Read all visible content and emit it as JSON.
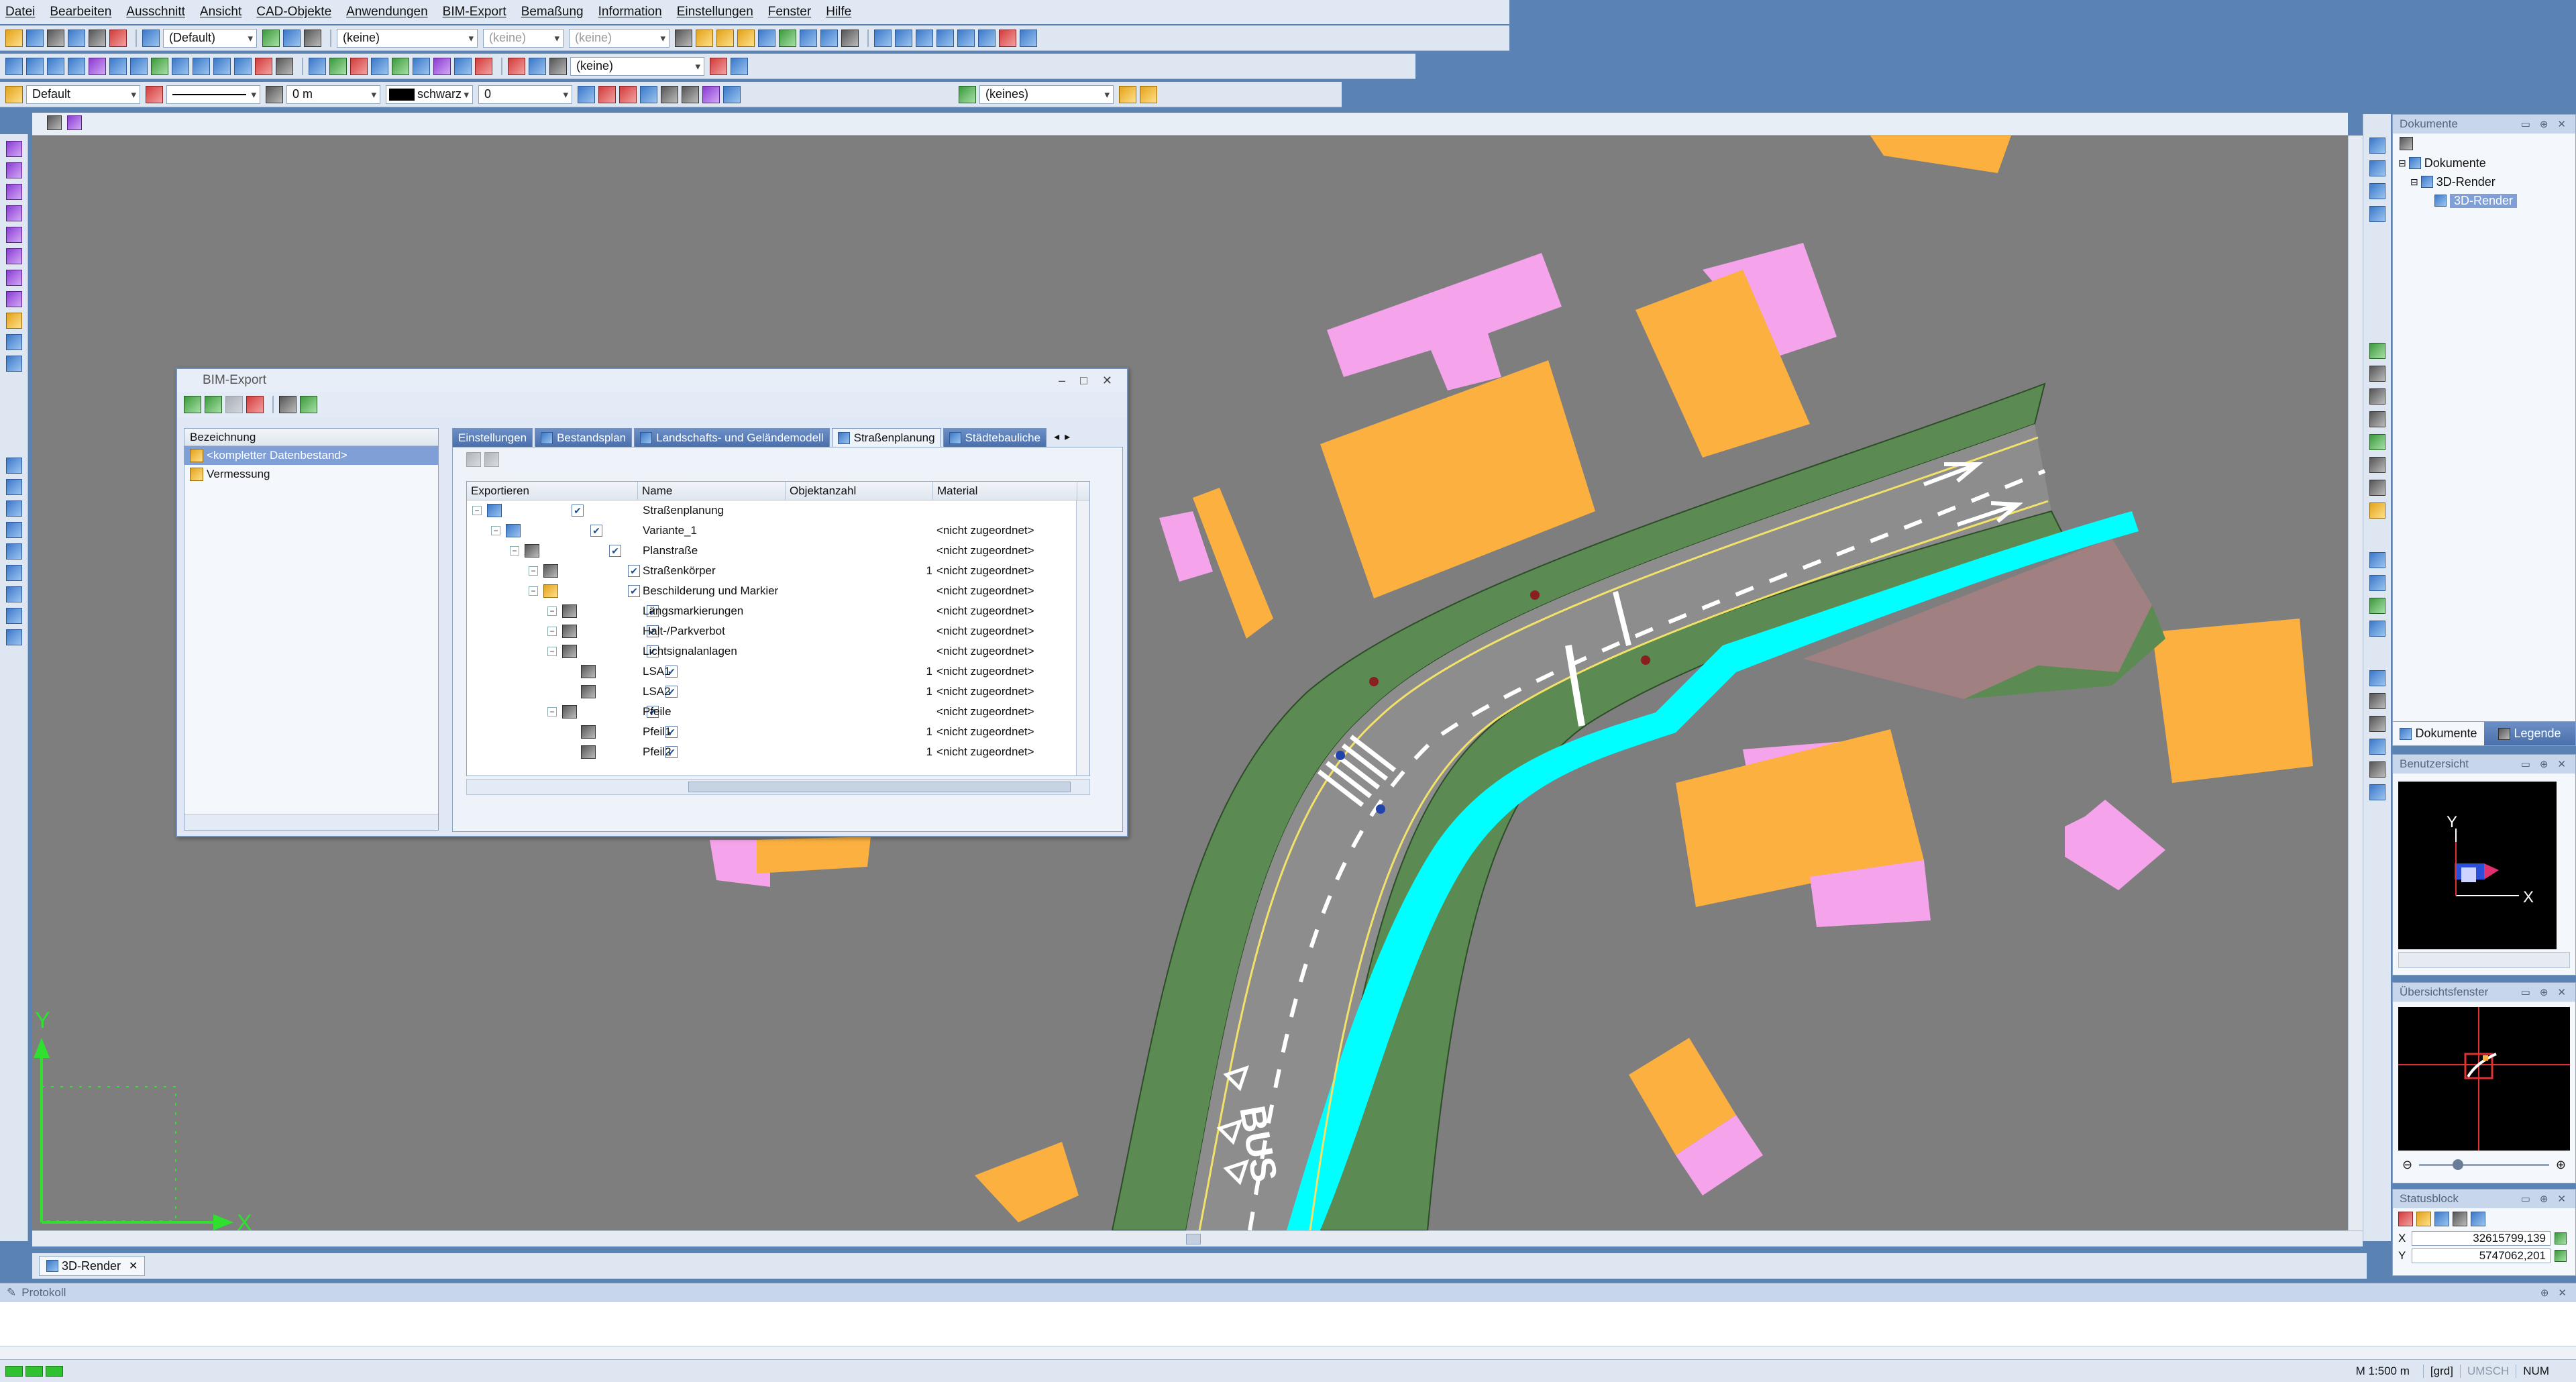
{
  "menu": [
    "Datei",
    "Bearbeiten",
    "Ausschnitt",
    "Ansicht",
    "CAD-Objekte",
    "Anwendungen",
    "BIM-Export",
    "Bemaßung",
    "Information",
    "Einstellungen",
    "Fenster",
    "Hilfe"
  ],
  "toolbar1": {
    "combo1": "(Default)",
    "combo2": "(keine)",
    "combo3": "(keine)",
    "combo4": "(keine)"
  },
  "toolbar2": {
    "combo1": "(keine)"
  },
  "toolbar3": {
    "layer": "Default",
    "length": "0 m",
    "color": "schwarz",
    "value": "0",
    "keines": "(keines)"
  },
  "dialog": {
    "title": "BIM-Export",
    "left_header": "Bezeichnung",
    "left_items": [
      "<kompletter Datenbestand>",
      "Vermessung"
    ],
    "tabs": [
      "Einstellungen",
      "Bestandsplan",
      "Landschafts- und Geländemodell",
      "Straßenplanung",
      "Städtebauliche"
    ],
    "columns": [
      "Exportieren",
      "Name",
      "Objektanzahl",
      "Material"
    ],
    "rows": [
      {
        "name": "Straßenplanung",
        "count": "",
        "material": ""
      },
      {
        "name": "Variante_1",
        "count": "",
        "material": "<nicht zugeordnet>"
      },
      {
        "name": "Planstraße",
        "count": "",
        "material": "<nicht zugeordnet>"
      },
      {
        "name": "Straßenkörper",
        "count": "1",
        "material": "<nicht zugeordnet>"
      },
      {
        "name": "Beschilderung und Markier",
        "count": "",
        "material": "<nicht zugeordnet>"
      },
      {
        "name": "Längsmarkierungen",
        "count": "",
        "material": "<nicht zugeordnet>"
      },
      {
        "name": "Halt-/Parkverbot",
        "count": "",
        "material": "<nicht zugeordnet>"
      },
      {
        "name": "Lichtsignalanlagen",
        "count": "",
        "material": "<nicht zugeordnet>"
      },
      {
        "name": "LSA1",
        "count": "1",
        "material": "<nicht zugeordnet>"
      },
      {
        "name": "LSA2",
        "count": "1",
        "material": "<nicht zugeordnet>"
      },
      {
        "name": "Pfeile",
        "count": "",
        "material": "<nicht zugeordnet>"
      },
      {
        "name": "Pfeil1",
        "count": "1",
        "material": "<nicht zugeordnet>"
      },
      {
        "name": "Pfeil2",
        "count": "1",
        "material": "<nicht zugeordnet>"
      }
    ]
  },
  "documents": {
    "title": "Dokumente",
    "root": "Dokumente",
    "child": "3D-Render",
    "leaf": "3D-Render",
    "tab_docs": "Dokumente",
    "tab_legend": "Legende"
  },
  "benutzersicht": {
    "title": "Benutzersicht",
    "y": "Y",
    "x": "X"
  },
  "uebersicht": {
    "title": "Übersichtsfenster"
  },
  "statusblock": {
    "title": "Statusblock",
    "x_label": "X",
    "x_value": "32615799,139",
    "y_label": "Y",
    "y_value": "5747062,201"
  },
  "canvas": {
    "axis_x": "X",
    "axis_y": "Y",
    "road_text": "BUS"
  },
  "doc_tab": "3D-Render",
  "protokoll": "Protokoll",
  "status": {
    "scale": "M 1:500",
    "unit": "m",
    "grd": "[grd]",
    "umsch": "UMSCH",
    "num": "NUM"
  },
  "colors": {
    "building": "#fbb040",
    "building_roof": "#f5a3ea",
    "green": "#5b8a52",
    "cyan": "#00ffff",
    "road": "#8d8d8d",
    "canvas": "#7e7e7e"
  }
}
